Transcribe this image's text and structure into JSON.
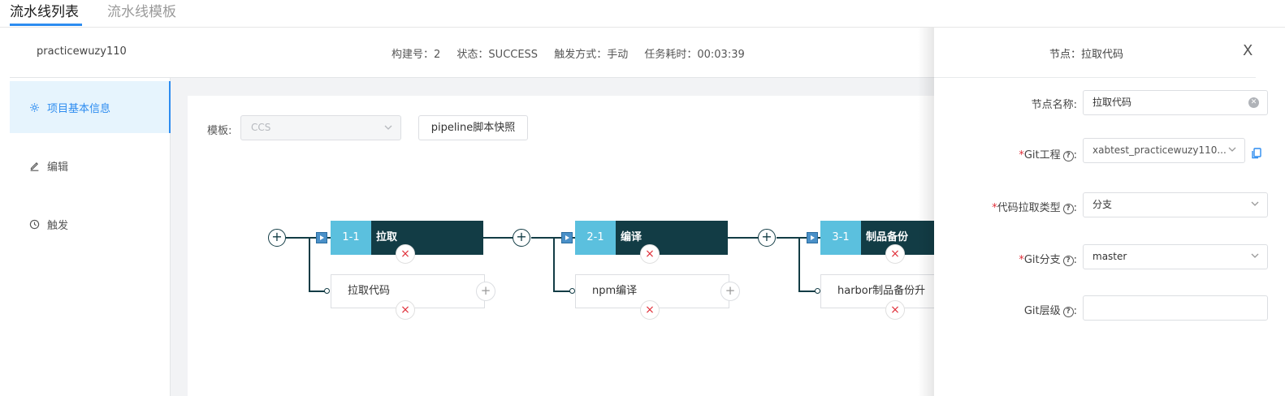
{
  "tabs": [
    {
      "label": "流水线列表"
    },
    {
      "label": "流水线模板"
    }
  ],
  "info": {
    "project_name": "practicewuzy110",
    "build_no": "构建号：2",
    "status": "状态：SUCCESS",
    "trigger": "触发方式：手动",
    "duration": "任务耗时：00:03:39"
  },
  "sidebar": {
    "items": [
      {
        "label": "项目基本信息",
        "icon": "gear-icon"
      },
      {
        "label": "编辑",
        "icon": "edit-icon"
      },
      {
        "label": "触发",
        "icon": "clock-icon"
      }
    ]
  },
  "toolbar": {
    "template_label": "模板:",
    "template_value": "CCS",
    "snapshot_button": "pipeline脚本快照"
  },
  "pipeline": {
    "stages": [
      {
        "num": "1-1",
        "name": "拉取",
        "job": "拉取代码"
      },
      {
        "num": "2-1",
        "name": "编译",
        "job": "npm编译"
      },
      {
        "num": "3-1",
        "name": "制品备份",
        "job": "harbor制品备份升"
      }
    ],
    "add_symbol": "+",
    "delete_symbol": "×"
  },
  "drawer": {
    "title": "节点：拉取代码",
    "close_symbol": "X",
    "required_mark": "*",
    "fields": {
      "node_name_label": "节点名称:",
      "node_name_value": "拉取代码",
      "git_project_label": "Git工程",
      "git_project_value": "xabtest_practicewuzy110...",
      "pull_type_label": "代码拉取类型",
      "pull_type_value": "分支",
      "git_branch_label": "Git分支",
      "git_branch_value": "master",
      "git_depth_label": "Git层级",
      "git_depth_value": ""
    }
  },
  "colors": {
    "accent": "#2d8cf0",
    "stage_dark": "#123c45",
    "stage_light": "#5bc0de",
    "danger": "#e0303a"
  }
}
